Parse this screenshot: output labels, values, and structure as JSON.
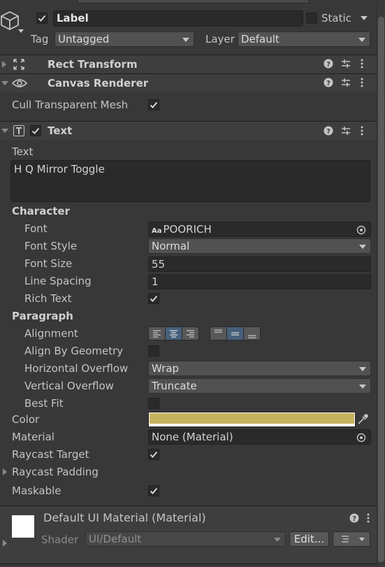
{
  "header": {
    "name_value": "Label",
    "static_label": "Static",
    "tag_label": "Tag",
    "tag_value": "Untagged",
    "layer_label": "Layer",
    "layer_value": "Default"
  },
  "components": {
    "rect_transform": {
      "title": "Rect Transform"
    },
    "canvas_renderer": {
      "title": "Canvas Renderer",
      "cull_label": "Cull Transparent Mesh"
    },
    "text": {
      "title": "Text",
      "text_label": "Text",
      "text_value": "H Q  Mirror Toggle",
      "character": {
        "section_label": "Character",
        "font_label": "Font",
        "font_icon": "Aa",
        "font_value": "POORICH",
        "font_style_label": "Font Style",
        "font_style_value": "Normal",
        "font_size_label": "Font Size",
        "font_size_value": "55",
        "line_spacing_label": "Line Spacing",
        "line_spacing_value": "1",
        "rich_text_label": "Rich Text"
      },
      "paragraph": {
        "section_label": "Paragraph",
        "alignment_label": "Alignment",
        "align_by_geometry_label": "Align By Geometry",
        "horizontal_overflow_label": "Horizontal Overflow",
        "horizontal_overflow_value": "Wrap",
        "vertical_overflow_label": "Vertical Overflow",
        "vertical_overflow_value": "Truncate",
        "best_fit_label": "Best Fit"
      },
      "color_label": "Color",
      "color_value": "#c7b260",
      "material_label": "Material",
      "material_value": "None (Material)",
      "raycast_target_label": "Raycast Target",
      "raycast_padding_label": "Raycast Padding",
      "maskable_label": "Maskable"
    }
  },
  "material_panel": {
    "title": "Default UI Material (Material)",
    "shader_label": "Shader",
    "shader_value": "UI/Default",
    "edit_button": "Edit..."
  },
  "checks": {
    "active": true,
    "static": false,
    "cull_transparent_mesh": true,
    "text_enabled": true,
    "rich_text": true,
    "align_by_geometry": false,
    "best_fit": false,
    "raycast_target": true,
    "maskable": true
  },
  "icons": {
    "gameobject": "cube-icon",
    "rect_transform": "move-arrows-icon",
    "canvas_renderer": "eye-icon",
    "text": "text-component-icon",
    "help": "help-icon",
    "presets": "sliders-icon",
    "menu": "kebab-menu-icon",
    "object_picker": "target-circle-icon",
    "eyedropper": "eyedropper-icon"
  }
}
